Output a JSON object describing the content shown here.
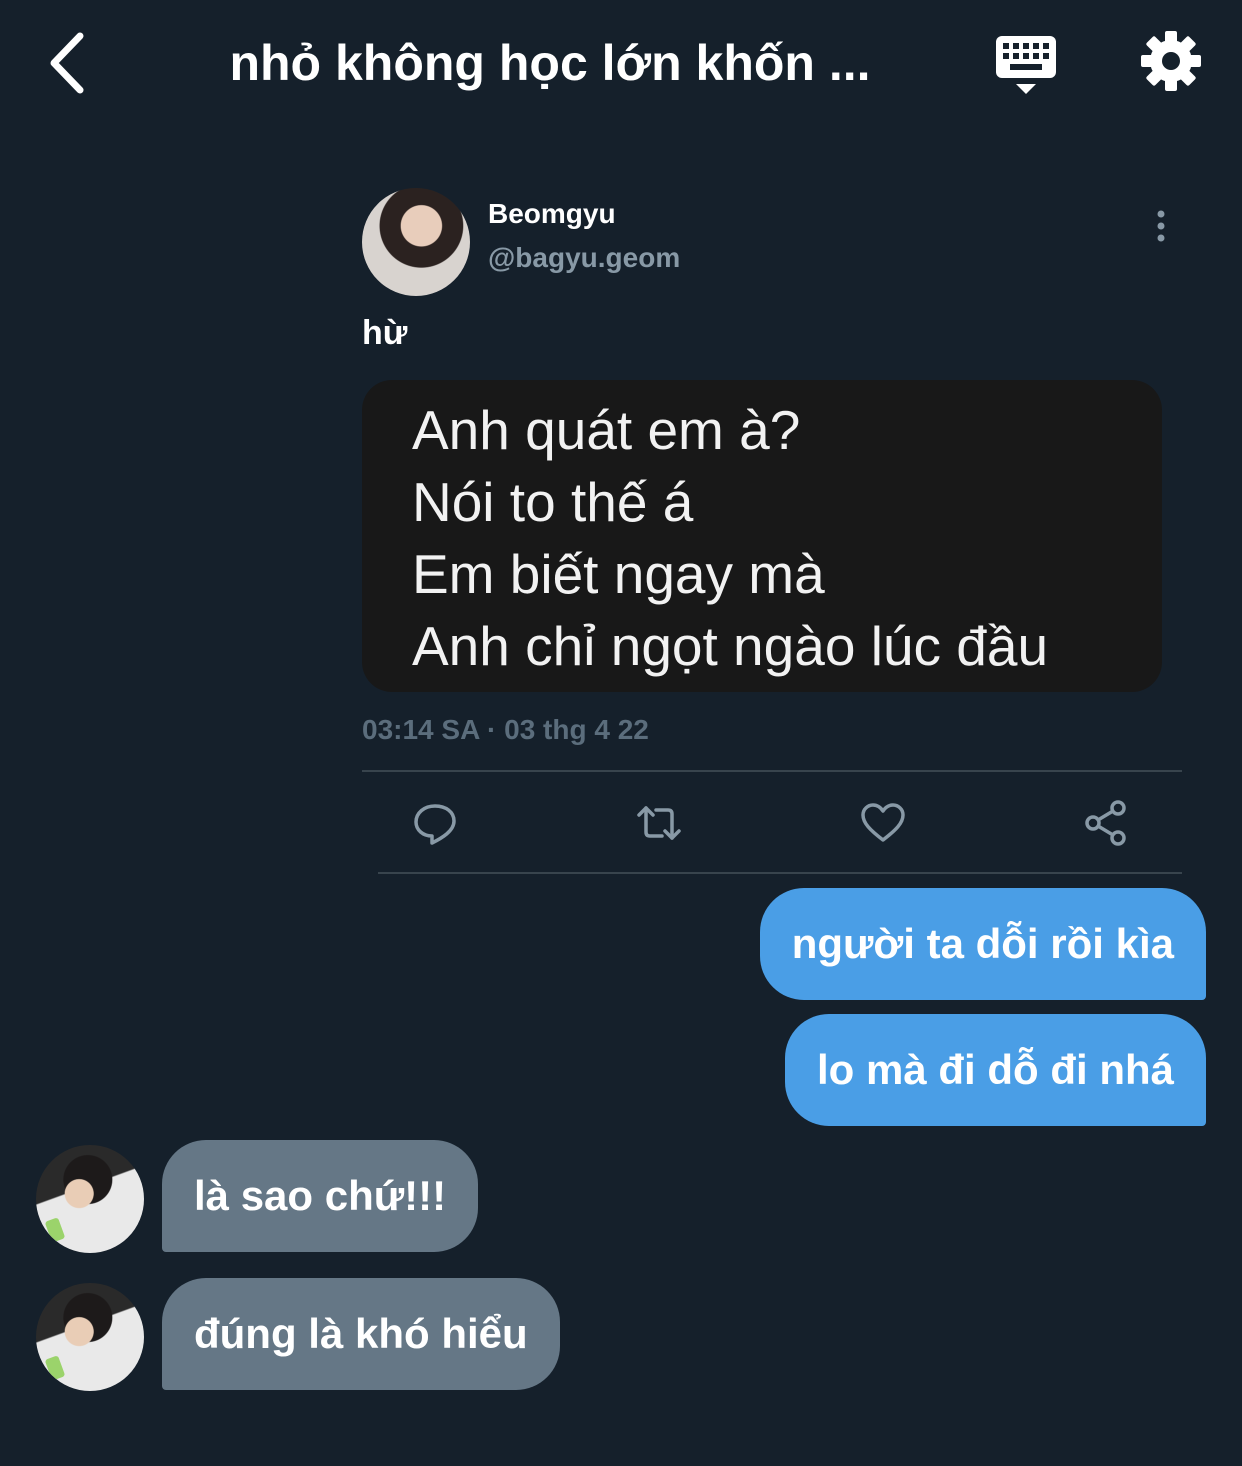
{
  "header": {
    "title": "nhỏ không học lớn khốn ...",
    "back_icon": "chevron-left-icon",
    "keyboard_icon": "keyboard-dismiss-icon",
    "settings_icon": "gear-icon"
  },
  "tweet": {
    "author_name": "Beomgyu",
    "author_handle": "@bagyu.geom",
    "text": "hừ",
    "media_lines": [
      "Anh quát em à?",
      "Nói to thế á",
      "Em biết ngay mà",
      "Anh chỉ ngọt ngào lúc đầu"
    ],
    "meta": "03:14 SA · 03 thg 4 22",
    "actions": [
      "reply-icon",
      "retweet-icon",
      "like-icon",
      "share-icon"
    ]
  },
  "messages": [
    {
      "direction": "out",
      "text": "người ta dỗi rồi kìa"
    },
    {
      "direction": "out",
      "text": "lo mà đi dỗ đi nhá"
    },
    {
      "direction": "in",
      "text": "là sao chứ!!!"
    },
    {
      "direction": "in",
      "text": "đúng là khó hiểu"
    }
  ],
  "colors": {
    "background": "#15202b",
    "outgoing_bubble": "#4a9ee6",
    "incoming_bubble": "#657786",
    "muted_text": "#8899a6"
  }
}
